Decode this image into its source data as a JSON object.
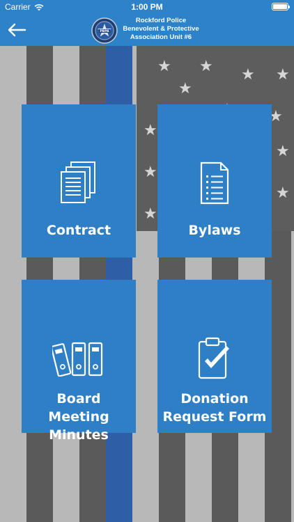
{
  "status_bar": {
    "carrier": "Carrier",
    "time": "1:00 PM"
  },
  "nav": {
    "back_icon": "arrow-left-icon",
    "title_lines": [
      "Rockford Police",
      "Benevolent & Protective",
      "Association Unit #6"
    ],
    "logo": "pbpa-badge-logo"
  },
  "tiles": [
    {
      "id": "contract",
      "label_lines": [
        "Contract"
      ],
      "icon": "documents-stack-icon"
    },
    {
      "id": "bylaws",
      "label_lines": [
        "Bylaws"
      ],
      "icon": "document-list-icon"
    },
    {
      "id": "board-meeting-minutes",
      "label_lines": [
        "Board Meeting",
        "Minutes"
      ],
      "icon": "binders-icon"
    },
    {
      "id": "donation-request-form",
      "label_lines": [
        "Donation",
        "Request Form"
      ],
      "icon": "clipboard-check-icon"
    }
  ],
  "colors": {
    "primary": "#2e82c8",
    "tile": "#2f7fc6",
    "thin_blue_line": "#2e5fa6"
  }
}
